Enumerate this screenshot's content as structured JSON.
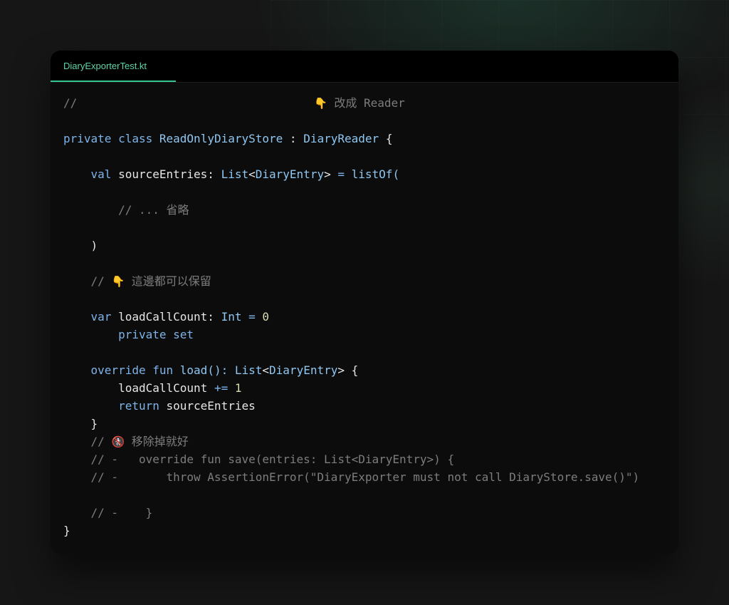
{
  "tab": {
    "label": "DiaryExporterTest.kt"
  },
  "code": {
    "l1_comment": "//",
    "l1_note_emoji": "👇",
    "l1_note_text": "改成 Reader",
    "l3_private": "private",
    "l3_class": "class",
    "l3_name": "ReadOnlyDiaryStore",
    "l3_colon": ":",
    "l3_iface": "DiaryReader",
    "l3_brace": "{",
    "l5_val": "val",
    "l5_name": "sourceEntries:",
    "l5_list": "List",
    "l5_lt": "<",
    "l5_entry": "DiaryEntry",
    "l5_gt": ">",
    "l5_eq": "=",
    "l5_listof": "listOf(",
    "l7_comment": "// ... 省略",
    "l9_paren": ")",
    "l11_comment": "//",
    "l11_emoji": "👇",
    "l11_text": "這邊都可以保留",
    "l13_var": "var",
    "l13_name": "loadCallCount:",
    "l13_type": "Int",
    "l13_eq": "=",
    "l13_num": "0",
    "l14_private": "private",
    "l14_set": "set",
    "l16_override": "override",
    "l16_fun": "fun",
    "l16_name": "load():",
    "l16_list": "List",
    "l16_lt": "<",
    "l16_entry": "DiaryEntry",
    "l16_gt": ">",
    "l16_brace": "{",
    "l17_name": "loadCallCount",
    "l17_op": "+=",
    "l17_num": "1",
    "l18_return": "return",
    "l18_name": "sourceEntries",
    "l19_brace": "}",
    "l20_comment": "//",
    "l20_emoji": "🚷",
    "l20_text": "移除掉就好",
    "l21_comment": "// -   override fun save(entries: List<DiaryEntry>) {",
    "l22_comment": "// -       throw AssertionError(\"DiaryExporter must not call DiaryStore.save()\")",
    "l24_comment": "// -    }",
    "l25_brace": "}"
  },
  "colors": {
    "keyword": "#7eb4ea",
    "type": "#8fc7f2",
    "number": "#d7dcb0",
    "comment": "#7d7d7d",
    "text": "#e6e6e6",
    "tab_accent": "#35c690"
  }
}
